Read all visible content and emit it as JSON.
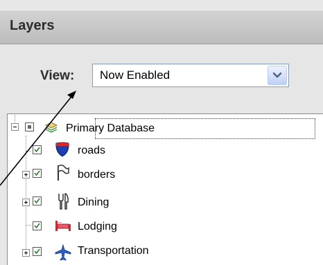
{
  "panel": {
    "title": "Layers"
  },
  "view": {
    "label": "View:",
    "selected": "Now Enabled"
  },
  "tree": {
    "root": {
      "label": "Primary Database",
      "icon": "layers-stack-icon"
    },
    "items": [
      {
        "label": "roads",
        "icon": "interstate-shield-icon",
        "checked": true,
        "expandable": false
      },
      {
        "label": "borders",
        "icon": "flag-icon",
        "checked": true,
        "expandable": true
      },
      {
        "label": "Dining",
        "icon": "fork-knife-icon",
        "checked": true,
        "expandable": true
      },
      {
        "label": "Lodging",
        "icon": "bed-icon",
        "checked": true,
        "expandable": false
      },
      {
        "label": "Transportation",
        "icon": "airplane-icon",
        "checked": true,
        "expandable": true
      }
    ]
  },
  "colors": {
    "header_bg": "#c7c7c7",
    "panel_bg": "#e6e6e6",
    "select_border": "#7f9db9"
  }
}
